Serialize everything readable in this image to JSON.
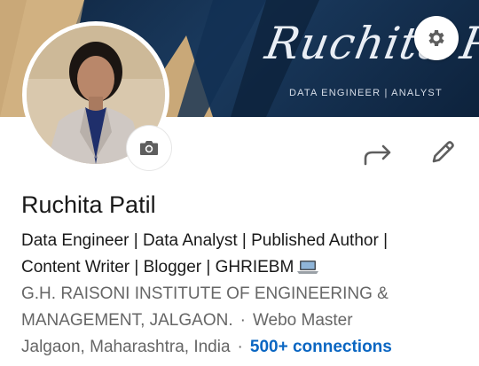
{
  "cover": {
    "name": "Ruchita Patil",
    "subtitle": "DATA ENGINEER | ANALYST"
  },
  "profile": {
    "name": "Ruchita Patil",
    "headline_line1": "Data Engineer | Data Analyst | Published Author |",
    "headline_line2": "Content Writer | Blogger | GHRIEBM",
    "school_line1": "G.H. RAISONI INSTITUTE OF ENGINEERING &",
    "school_line2": "MANAGEMENT, JALGAON.",
    "company": "Webo Master",
    "location": "Jalgaon, Maharashtra, India",
    "connections": "500+ connections",
    "separator": "·"
  },
  "icons": [
    "gear-icon",
    "camera-icon",
    "share-icon",
    "pencil-icon",
    "laptop-icon"
  ],
  "colors": {
    "link": "#0a66c2",
    "cover_dark": "#0f2540",
    "muted_text": "#666666",
    "primary_text": "#191919"
  }
}
